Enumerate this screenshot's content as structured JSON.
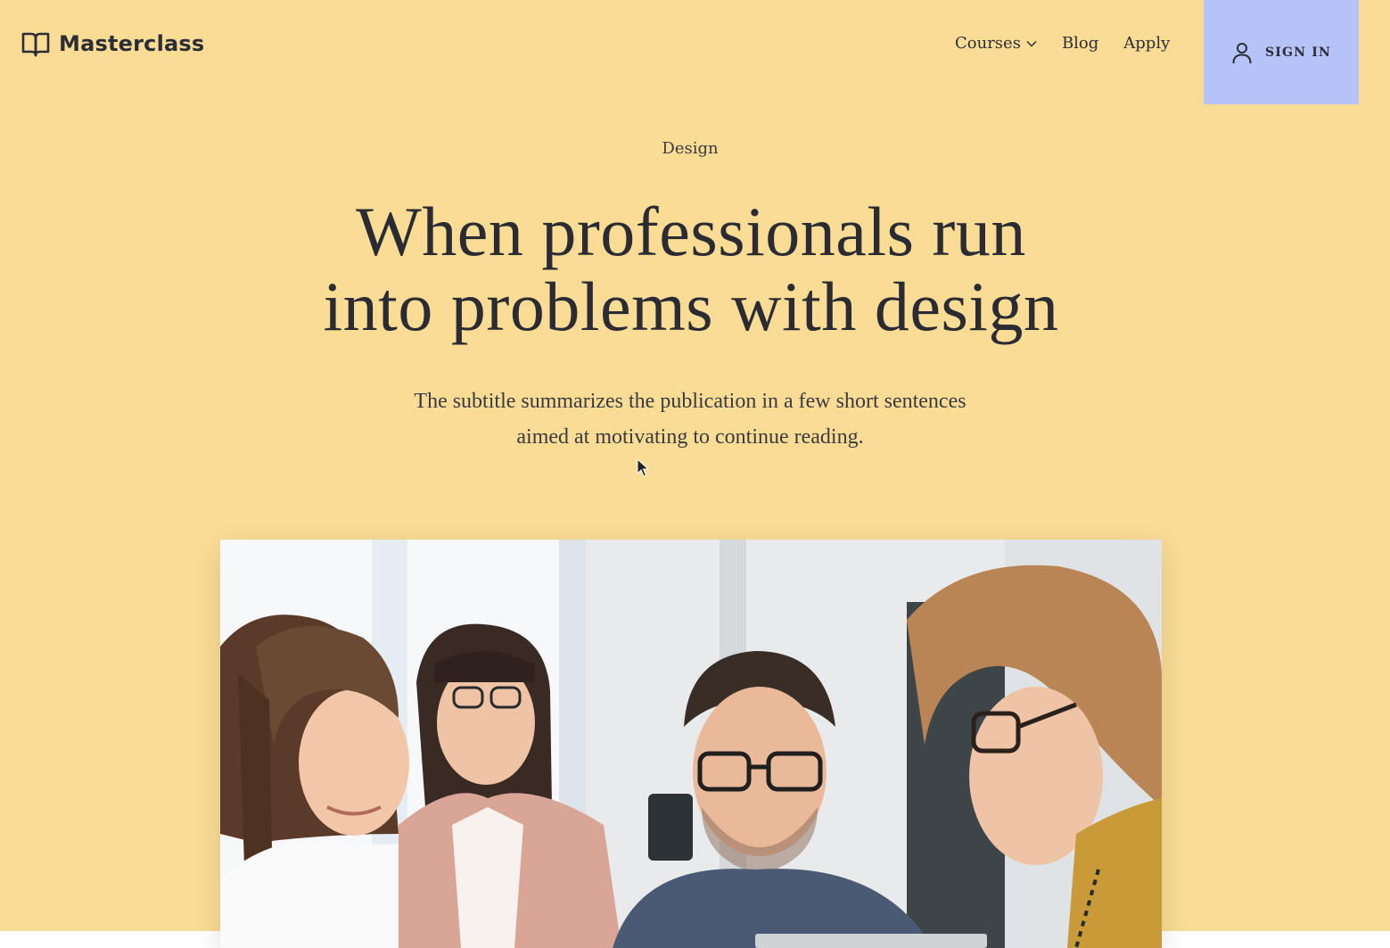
{
  "header": {
    "logo_text": "Masterclass",
    "logo_icon": "open-book-icon",
    "nav": {
      "courses_label": "Courses",
      "blog_label": "Blog",
      "apply_label": "Apply"
    },
    "signin_label": "SIGN IN",
    "signin_icon": "user-icon"
  },
  "hero": {
    "category": "Design",
    "title_line1": "When professionals run",
    "title_line2": "into problems with design",
    "subtitle_line1": "The subtitle summarizes the publication in a few short sentences",
    "subtitle_line2": "aimed at motivating to continue reading."
  },
  "colors": {
    "background": "#fadc94",
    "signin_bg": "#b5c3f8",
    "text": "#2b2b33"
  }
}
